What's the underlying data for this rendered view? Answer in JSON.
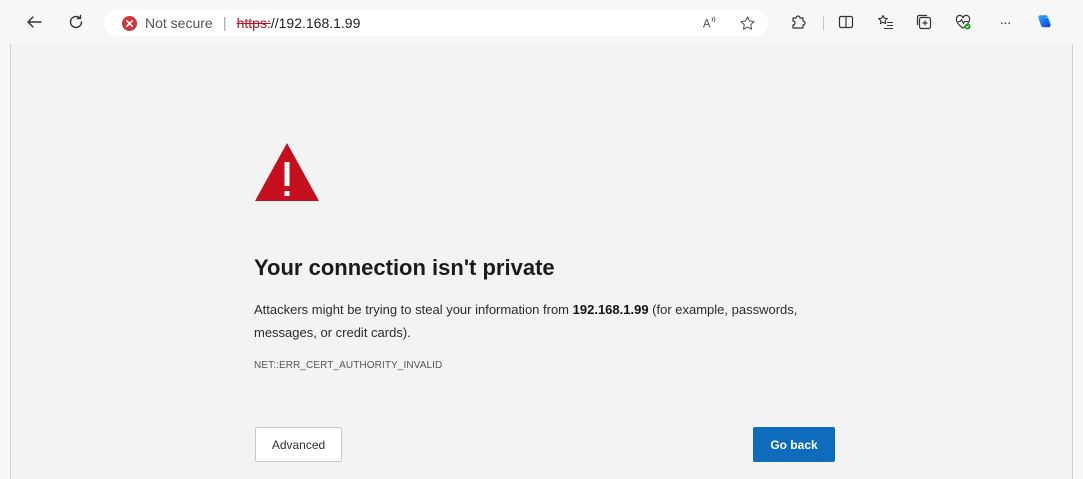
{
  "browser": {
    "address": {
      "security_label": "Not secure",
      "separator": "|",
      "protocol": "https:",
      "host_path": "//192.168.1.99"
    },
    "more_label": "···"
  },
  "page": {
    "headline": "Your connection isn't private",
    "desc_part1": "Attackers might be trying to steal your information from ",
    "desc_host": "192.168.1.99",
    "desc_part2": " (for example, passwords, messages, or credit cards).",
    "error_code": "NET::ERR_CERT_AUTHORITY_INVALID",
    "advanced_label": "Advanced",
    "go_back_label": "Go back"
  },
  "colors": {
    "warning_red": "#c50f1f",
    "primary_button": "#0f6cbd"
  }
}
